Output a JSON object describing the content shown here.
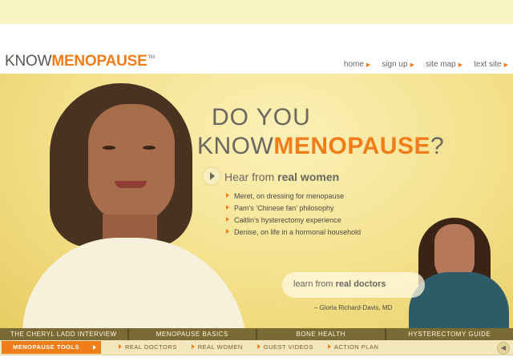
{
  "logo": {
    "part1": "KNOW",
    "part2": "MENOPAUSE",
    "tm": "TM"
  },
  "topnav": [
    {
      "label": "home"
    },
    {
      "label": "sign up"
    },
    {
      "label": "site map"
    },
    {
      "label": "text site"
    }
  ],
  "hero": {
    "headline_line1": "DO YOU",
    "headline_know": "KNOW",
    "headline_brand": "MENOPAUSE",
    "headline_q": "?",
    "hear_prefix": "Hear from ",
    "hear_bold": "real women",
    "women_items": [
      "Meret, on dressing for menopause",
      "Pam's ‘Chinese fan’ philosophy",
      "Caitlin's hysterectomy experience",
      "Denise, on life in a hormonal household"
    ],
    "doctors_prefix": "learn from ",
    "doctors_bold": "real doctors",
    "doctor_name": "– Gloria Richard-Davis, MD"
  },
  "tabs": [
    "THE CHERYL LADD INTERVIEW",
    "MENOPAUSE BASICS",
    "BONE HEALTH",
    "HYSTERECTOMY GUIDE"
  ],
  "tools": {
    "label": "MENOPAUSE TOOLS",
    "links": [
      "REAL DOCTORS",
      "REAL WOMEN",
      "GUEST VIDEOS",
      "ACTION PLAN"
    ]
  },
  "colors": {
    "accent": "#ef7d1a",
    "text": "#6a6660",
    "hero_bg": "#f4e08a"
  },
  "icons": {
    "speaker": "speaker-icon",
    "play": "play-icon"
  }
}
